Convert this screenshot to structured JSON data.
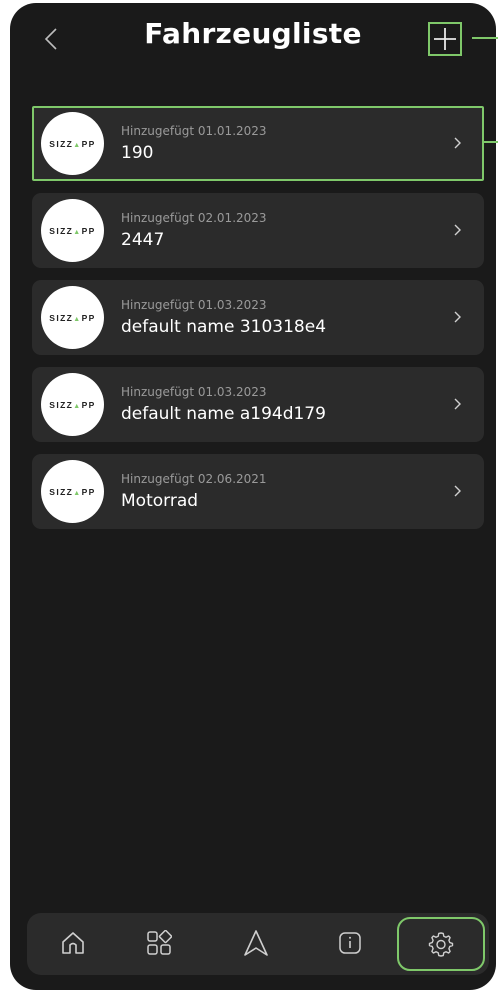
{
  "header": {
    "title": "Fahrzeugliste",
    "back_icon": "chevron-left-icon",
    "add_icon": "plus-icon"
  },
  "logo_text": "SIZZAPP",
  "vehicles": [
    {
      "added": "Hinzugefügt 01.01.2023",
      "name": "190",
      "selected": true
    },
    {
      "added": "Hinzugefügt 02.01.2023",
      "name": "2447",
      "selected": false
    },
    {
      "added": "Hinzugefügt 01.03.2023",
      "name": "default name 310318e4",
      "selected": false
    },
    {
      "added": "Hinzugefügt 01.03.2023",
      "name": "default name a194d179",
      "selected": false
    },
    {
      "added": "Hinzugefügt 02.06.2021",
      "name": "Motorrad",
      "selected": false
    }
  ],
  "tabbar": {
    "tabs": [
      {
        "icon": "home-icon"
      },
      {
        "icon": "apps-icon"
      },
      {
        "icon": "navigation-icon"
      },
      {
        "icon": "info-icon"
      },
      {
        "icon": "settings-icon",
        "active": true
      }
    ]
  },
  "colors": {
    "accent": "#7fc86a",
    "background": "#1a1a1a",
    "card": "#2b2b2b"
  }
}
